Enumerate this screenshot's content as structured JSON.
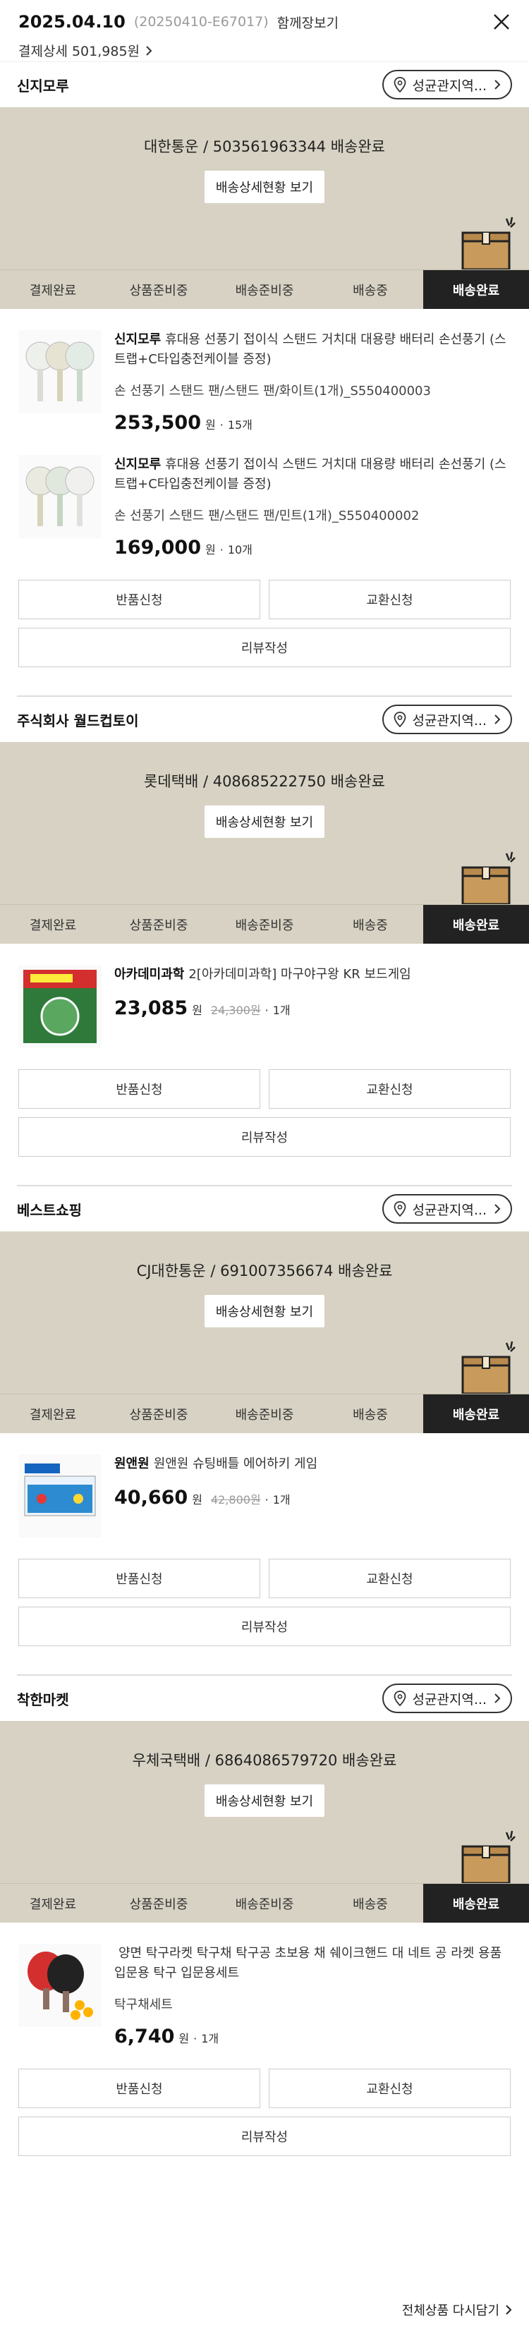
{
  "header": {
    "date": "2025.04.10",
    "order_no": "(20250410-E67017)",
    "cart_link": "함께장보기",
    "payment_detail": "결제상세 501,985원"
  },
  "steps": [
    "결제완료",
    "상품준비중",
    "배송준비중",
    "배송중",
    "배송완료"
  ],
  "active_step": "배송완료",
  "sellers": [
    {
      "name": "신지모루",
      "store_button": "성균관지역...",
      "carrier": "대한통운 / 503561963344 배송완료",
      "detail_button": "배송상세현황 보기",
      "items": [
        {
          "brand": "신지모루",
          "title": "휴대용 선풍기 접이식 스탠드 거치대 대용량 배터리 손선풍기 (스트랩+C타입충전케이블 증정)",
          "option": "손 선풍기 스탠드 팬/스탠드 팬/화이트(1개)_S550400003",
          "price": "253,500",
          "won": "원",
          "original": "",
          "qty": "15개"
        },
        {
          "brand": "신지모루",
          "title": "휴대용 선풍기 접이식 스탠드 거치대 대용량 배터리 손선풍기 (스트랩+C타입충전케이블 증정)",
          "option": "손 선풍기 스탠드 팬/스탠드 팬/민트(1개)_S550400002",
          "price": "169,000",
          "won": "원",
          "original": "",
          "qty": "10개"
        }
      ],
      "buttons": {
        "return": "반품신청",
        "exchange": "교환신청",
        "review": "리뷰작성"
      }
    },
    {
      "name": "주식회사 월드컵토이",
      "store_button": "성균관지역...",
      "carrier": "롯데택배 / 408685222750 배송완료",
      "detail_button": "배송상세현황 보기",
      "items": [
        {
          "brand": "아카데미과학",
          "title": "2[아카데미과학] 마구야구왕 KR 보드게임",
          "option": "",
          "price": "23,085",
          "won": "원",
          "original": "24,300원",
          "qty": "1개"
        }
      ],
      "buttons": {
        "return": "반품신청",
        "exchange": "교환신청",
        "review": "리뷰작성"
      }
    },
    {
      "name": "베스트쇼핑",
      "store_button": "성균관지역...",
      "carrier": "CJ대한통운 / 691007356674 배송완료",
      "detail_button": "배송상세현황 보기",
      "items": [
        {
          "brand": "원앤원",
          "title": "원앤원 슈팅배틀 에어하키 게임",
          "option": "",
          "price": "40,660",
          "won": "원",
          "original": "42,800원",
          "qty": "1개"
        }
      ],
      "buttons": {
        "return": "반품신청",
        "exchange": "교환신청",
        "review": "리뷰작성"
      }
    },
    {
      "name": "착한마켓",
      "store_button": "성균관지역...",
      "carrier": "우체국택배 / 6864086579720 배송완료",
      "detail_button": "배송상세현황 보기",
      "items": [
        {
          "brand": "",
          "title": "양면 탁구라켓 탁구채 탁구공 초보용 채 쉐이크핸드 대 네트 공 라켓 용품 입문용 탁구 입문용세트",
          "option": "탁구채세트",
          "price": "6,740",
          "won": "원",
          "original": "",
          "qty": "1개"
        }
      ],
      "buttons": {
        "return": "반품신청",
        "exchange": "교환신청",
        "review": "리뷰작성"
      }
    }
  ],
  "footer": {
    "reorder_all": "전체상품 다시담기"
  },
  "colors": {
    "panel_bg": "#d7d2c3",
    "active_step_bg": "#222222",
    "box_brown": "#c89a5b"
  }
}
